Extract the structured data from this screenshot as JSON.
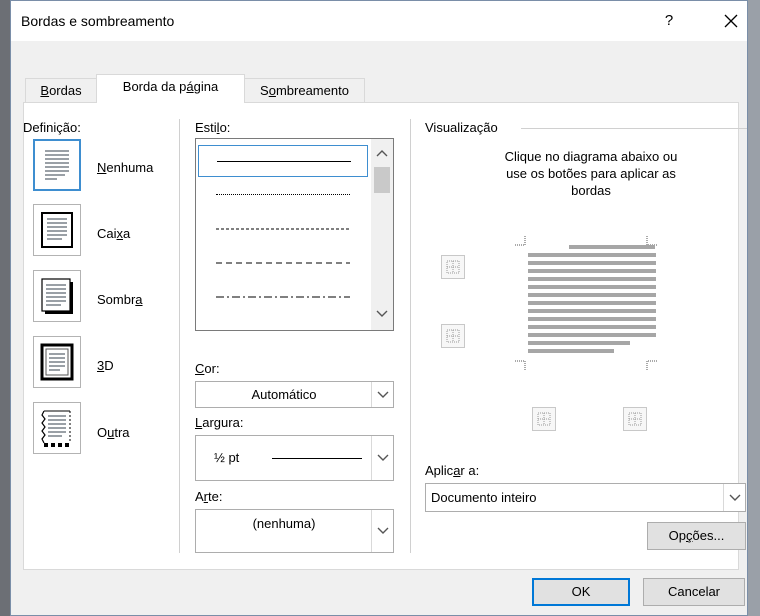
{
  "dialog": {
    "title": "Bordas e sombreamento",
    "help": "?",
    "close": "✕"
  },
  "tabs": [
    {
      "label": "Bordas",
      "mnemonic": "B",
      "rest": "ordas"
    },
    {
      "label": "Borda da página",
      "pre": "Borda da p",
      "mnemonic": "á",
      "rest": "gina"
    },
    {
      "label": "Sombreamento",
      "pre": "S",
      "mnemonic": "o",
      "rest": "mbreamento"
    }
  ],
  "setting": {
    "label": "Definição:",
    "items": [
      {
        "label": "Nenhuma",
        "pre": "",
        "mnemonic": "N",
        "rest": "enhuma",
        "selected": true
      },
      {
        "label": "Caixa",
        "pre": "Cai",
        "mnemonic": "x",
        "rest": "a",
        "selected": false
      },
      {
        "label": "Sombra",
        "pre": "Sombr",
        "mnemonic": "a",
        "rest": "",
        "selected": false
      },
      {
        "label": "3D",
        "pre": "",
        "mnemonic": "3",
        "rest": "D",
        "selected": false
      },
      {
        "label": "Outra",
        "pre": "O",
        "mnemonic": "u",
        "rest": "tra",
        "selected": false
      }
    ]
  },
  "style": {
    "label_pre": "Esti",
    "label_mnemonic": "l",
    "label_rest": "o:",
    "selected_index": 0
  },
  "color": {
    "label_pre": "",
    "label_mnemonic": "C",
    "label_rest": "or:",
    "value": "Automático"
  },
  "width": {
    "label_pre": "",
    "label_mnemonic": "L",
    "label_rest": "argura:",
    "value": "½ pt"
  },
  "art": {
    "label_pre": "A",
    "label_mnemonic": "r",
    "label_rest": "te:",
    "value": "(nenhuma)"
  },
  "preview": {
    "label": "Visualização",
    "instructions_line1": "Clique no diagrama abaixo ou",
    "instructions_line2": "use os botões para aplicar as",
    "instructions_line3": "bordas"
  },
  "apply": {
    "label_pre": "Aplic",
    "label_mnemonic": "a",
    "label_rest": "r a:",
    "value": "Documento inteiro"
  },
  "buttons": {
    "options_pre": "Op",
    "options_mnemonic": "ç",
    "options_rest": "ões...",
    "ok": "OK",
    "cancel": "Cancelar"
  },
  "colors": {
    "accent": "#0078d7",
    "selected_border": "#3e8ed0",
    "dialog_bg": "#f0f0f0"
  }
}
